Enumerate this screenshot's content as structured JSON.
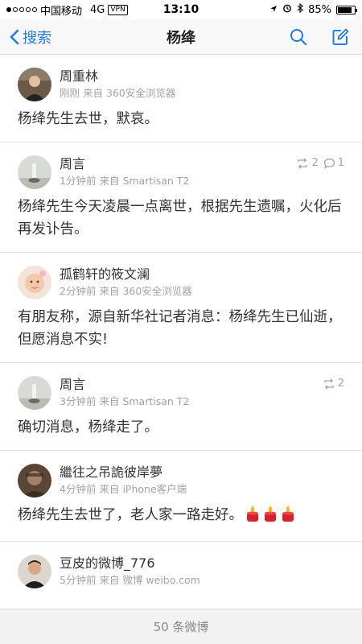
{
  "status_bar": {
    "carrier": "中国移动",
    "network": "4G",
    "vpn": "VPN",
    "time": "13:10",
    "battery_percent": "85%",
    "battery_level": 0.85
  },
  "nav": {
    "back_label": "搜索",
    "title": "杨绛",
    "accent_color": "#1e7de8"
  },
  "posts": [
    {
      "username": "周重林",
      "time": "刚刚",
      "source_prefix": "来自",
      "source": "360安全浏览器",
      "repost_count": "",
      "comment_count": "",
      "text": "杨绛先生去世，默哀。"
    },
    {
      "username": "周言",
      "time": "1分钟前",
      "source_prefix": "来自",
      "source": "Smartisan T2",
      "repost_count": "2",
      "comment_count": "1",
      "text": "杨绛先生今天凌晨一点离世，根据先生遗嘱，火化后再发讣告。"
    },
    {
      "username": "孤鹤轩的筱文澜",
      "time": "2分钟前",
      "source_prefix": "来自",
      "source": "360安全浏览器",
      "repost_count": "",
      "comment_count": "",
      "text": "有朋友称，源自新华社记者消息：杨绛先生已仙逝，但愿消息不实!"
    },
    {
      "username": "周言",
      "time": "3分钟前",
      "source_prefix": "来自",
      "source": "Smartisan T2",
      "repost_count": "2",
      "comment_count": "",
      "text": "确切消息，杨绛走了。"
    },
    {
      "username": "繼往之吊詭彼岸夢",
      "time": "4分钟前",
      "source_prefix": "来自",
      "source": "iPhone客户端",
      "repost_count": "",
      "comment_count": "",
      "text": "杨绛先生去世了，老人家一路走好。"
    },
    {
      "username": "豆皮的微博_776",
      "time": "5分钟前",
      "source_prefix": "来自",
      "source": "微博 weibo.com",
      "repost_count": "",
      "comment_count": "",
      "text": ""
    }
  ],
  "footer": {
    "label": "50 条微博"
  }
}
